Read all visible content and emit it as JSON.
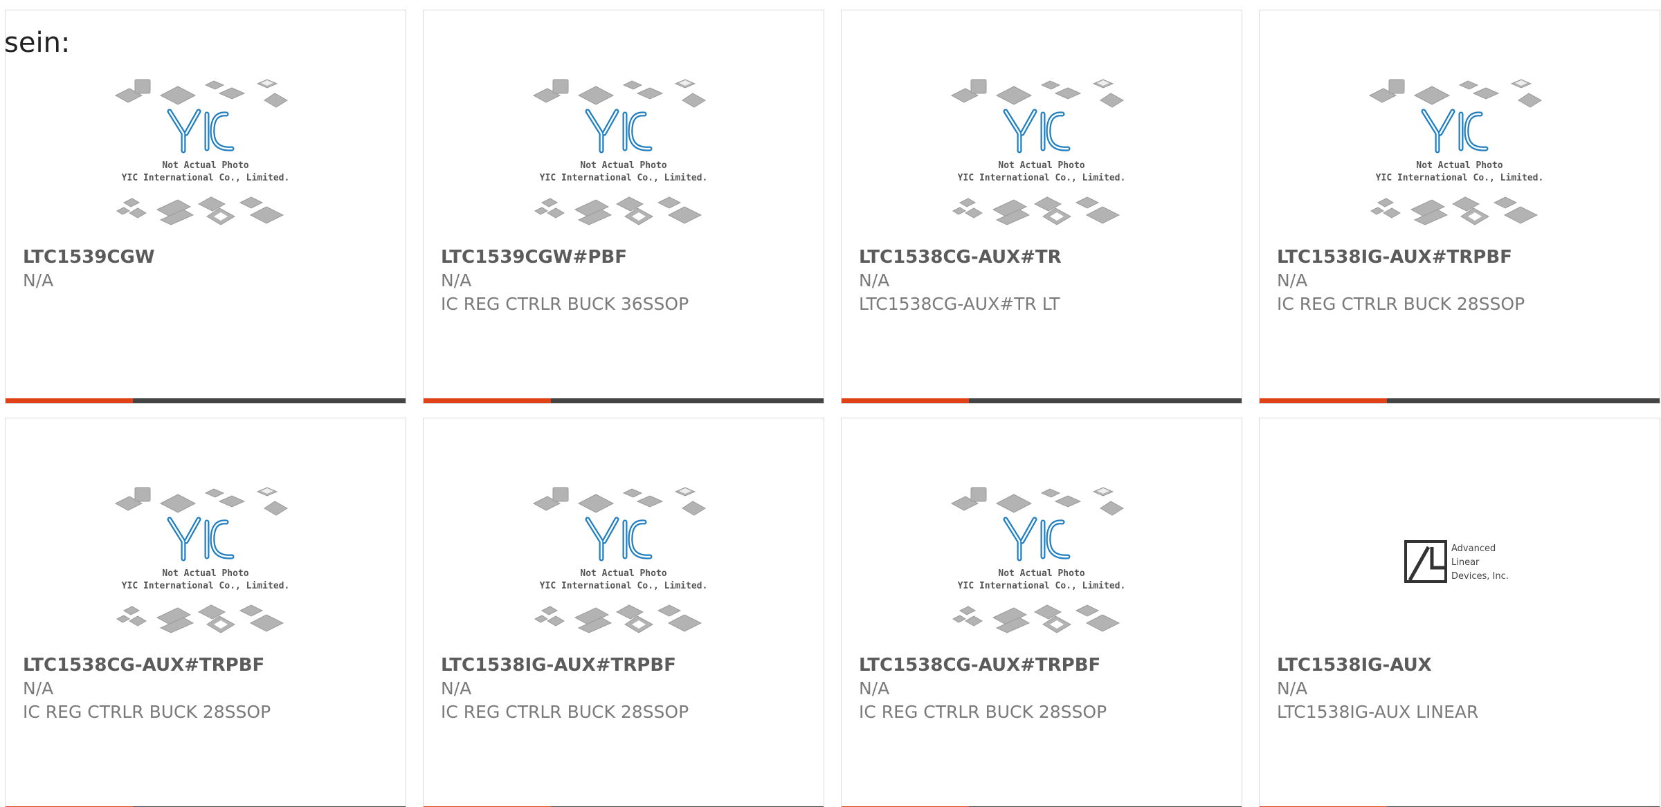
{
  "intro_text": "sein:",
  "placeholder_image": {
    "caption_line1": "Not Actual Photo",
    "caption_line2": "YIC International Co., Limited.",
    "logo_text": "YIC"
  },
  "ald_logo": {
    "line1": "Advanced",
    "line2": "Linear",
    "line3": "Devices, Inc."
  },
  "colors": {
    "accent": "#e14116",
    "bar": "#444444",
    "logo_blue": "#1f7fc0"
  },
  "products": [
    {
      "part": "LTC1539CGW",
      "mfr": "N/A",
      "desc": "",
      "image": "yic-placeholder"
    },
    {
      "part": "LTC1539CGW#PBF",
      "mfr": "N/A",
      "desc": "IC REG CTRLR BUCK 36SSOP",
      "image": "yic-placeholder"
    },
    {
      "part": "LTC1538CG-AUX#TR",
      "mfr": "N/A",
      "desc": "LTC1538CG-AUX#TR LT",
      "image": "yic-placeholder"
    },
    {
      "part": "LTC1538IG-AUX#TRPBF",
      "mfr": "N/A",
      "desc": "IC REG CTRLR BUCK 28SSOP",
      "image": "yic-placeholder"
    },
    {
      "part": "LTC1538CG-AUX#TRPBF",
      "mfr": "N/A",
      "desc": "IC REG CTRLR BUCK 28SSOP",
      "image": "yic-placeholder"
    },
    {
      "part": "LTC1538IG-AUX#TRPBF",
      "mfr": "N/A",
      "desc": "IC REG CTRLR BUCK 28SSOP",
      "image": "yic-placeholder"
    },
    {
      "part": "LTC1538CG-AUX#TRPBF",
      "mfr": "N/A",
      "desc": "IC REG CTRLR BUCK 28SSOP",
      "image": "yic-placeholder"
    },
    {
      "part": "LTC1538IG-AUX",
      "mfr": "N/A",
      "desc": "LTC1538IG-AUX LINEAR",
      "image": "ald-logo"
    }
  ]
}
